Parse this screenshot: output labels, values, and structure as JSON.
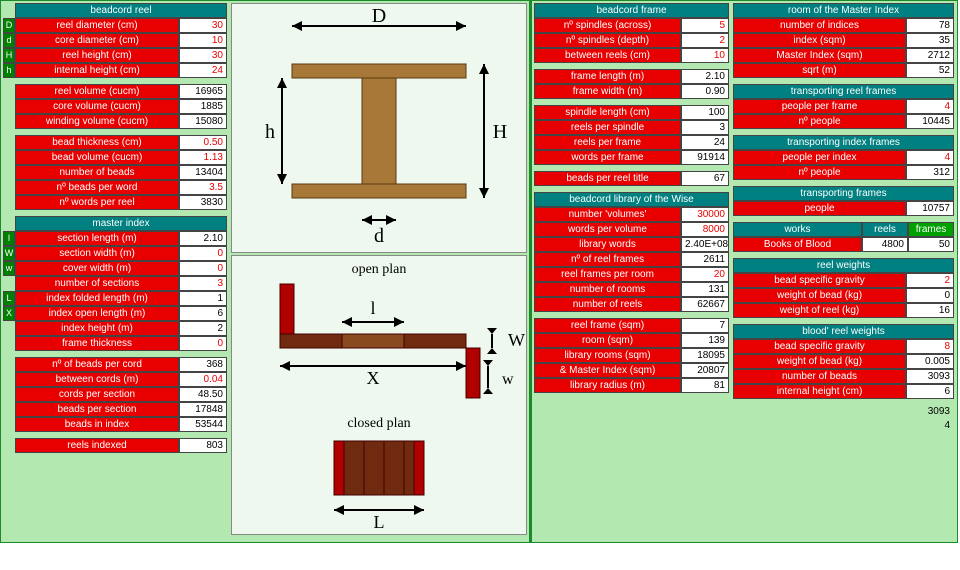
{
  "col_a": {
    "beadcord_reel": {
      "title": "beadcord reel",
      "rows": [
        {
          "tag": "D",
          "tagColor": "green",
          "label": "reel diameter (cm)",
          "value": "30",
          "red": true
        },
        {
          "tag": "d",
          "tagColor": "green",
          "label": "core diameter (cm)",
          "value": "10",
          "red": true
        },
        {
          "tag": "H",
          "tagColor": "green",
          "label": "reel height (cm)",
          "value": "30",
          "red": true
        },
        {
          "tag": "h",
          "tagColor": "green",
          "label": "internal height (cm)",
          "value": "24",
          "red": true
        }
      ]
    },
    "reel_volume": {
      "rows": [
        {
          "label": "reel volume (cucm)",
          "value": "16965"
        },
        {
          "label": "core volume (cucm)",
          "value": "1885"
        },
        {
          "label": "winding volume (cucm)",
          "value": "15080"
        }
      ]
    },
    "beads": {
      "rows": [
        {
          "label": "bead thickness (cm)",
          "value": "0.50",
          "red": true
        },
        {
          "label": "bead volume (cucm)",
          "value": "1.13",
          "red": true
        },
        {
          "label": "number of beads",
          "value": "13404"
        },
        {
          "label": "nº beads per word",
          "value": "3.5",
          "red": true
        },
        {
          "label": "nº words per reel",
          "value": "3830"
        }
      ]
    },
    "master_index": {
      "title": "master index",
      "rows": [
        {
          "tag": "l",
          "tagColor": "green",
          "label": "section length (m)",
          "value": "2.10"
        },
        {
          "tag": "W",
          "tagColor": "green",
          "label": "section width (m)",
          "value": "0",
          "red": true
        },
        {
          "tag": "w",
          "tagColor": "green",
          "label": "cover width (m)",
          "value": "0",
          "red": true
        },
        {
          "label": "number of sections",
          "value": "3",
          "red": true
        },
        {
          "tag": "L",
          "tagColor": "green",
          "label": "index folded length (m)",
          "value": "1"
        },
        {
          "tag": "X",
          "tagColor": "green",
          "label": "index open length (m)",
          "value": "6"
        },
        {
          "label": "index height (m)",
          "value": "2"
        },
        {
          "label": "frame thickness",
          "value": "0",
          "red": true
        }
      ]
    },
    "cords": {
      "rows": [
        {
          "label": "nº of beads per cord",
          "value": "368"
        },
        {
          "label": "between cords (m)",
          "value": "0.04",
          "red": true
        },
        {
          "label": "cords per section",
          "value": "48.50"
        },
        {
          "label": "beads per section",
          "value": "17848"
        },
        {
          "label": "beads in index",
          "value": "53544"
        }
      ]
    },
    "reels_indexed": {
      "rows": [
        {
          "label": "reels indexed",
          "value": "803"
        }
      ]
    }
  },
  "diagrams": {
    "open_plan": "open plan",
    "closed_plan": "closed plan",
    "D": "D",
    "d": "d",
    "H": "H",
    "h": "h",
    "l": "l",
    "L": "L",
    "W": "W",
    "w": "w",
    "X": "X"
  },
  "col_c": {
    "beadcord_frame": {
      "title": "beadcord frame",
      "rows": [
        {
          "label": "nº spindles (across)",
          "value": "5",
          "red": true
        },
        {
          "label": "nº spindles (depth)",
          "value": "2",
          "red": true
        },
        {
          "label": "between reels (cm)",
          "value": "10",
          "red": true
        }
      ]
    },
    "frame_dims": {
      "rows": [
        {
          "label": "frame length (m)",
          "value": "2.10"
        },
        {
          "label": "frame width (m)",
          "value": "0.90"
        }
      ]
    },
    "spindle": {
      "rows": [
        {
          "label": "spindle length (cm)",
          "value": "100"
        },
        {
          "label": "reels per spindle",
          "value": "3"
        },
        {
          "label": "reels per frame",
          "value": "24"
        },
        {
          "label": "words per frame",
          "value": "91914"
        }
      ]
    },
    "title_beads": {
      "rows": [
        {
          "label": "beads per reel title",
          "value": "67"
        }
      ]
    },
    "library": {
      "title": "beadcord library of the Wise",
      "rows": [
        {
          "label": "number 'volumes'",
          "value": "30000",
          "red": true
        },
        {
          "label": "words per volume",
          "value": "8000",
          "red": true
        },
        {
          "label": "library words",
          "value": "2.40E+08"
        },
        {
          "label": "nº of reel frames",
          "value": "2611"
        },
        {
          "label": "reel frames per room",
          "value": "20",
          "red": true
        },
        {
          "label": "number of rooms",
          "value": "131"
        },
        {
          "label": "number of reels",
          "value": "62667"
        }
      ]
    },
    "areas": {
      "rows": [
        {
          "label": "reel frame (sqm)",
          "value": "7"
        },
        {
          "label": "room (sqm)",
          "value": "139"
        },
        {
          "label": "library rooms (sqm)",
          "value": "18095"
        },
        {
          "label": "& Master Index (sqm)",
          "value": "20807"
        },
        {
          "label": "library radius (m)",
          "value": "81"
        }
      ]
    }
  },
  "col_d": {
    "master_room": {
      "title": "room of the Master Index",
      "rows": [
        {
          "label": "number of indices",
          "value": "78"
        },
        {
          "label": "index (sqm)",
          "value": "35"
        },
        {
          "label": "Master Index (sqm)",
          "value": "2712"
        },
        {
          "label": "sqrt (m)",
          "value": "52"
        }
      ]
    },
    "trans_reel": {
      "title": "transporting reel frames",
      "rows": [
        {
          "label": "people per frame",
          "value": "4",
          "red": true
        },
        {
          "label": "nº people",
          "value": "10445"
        }
      ]
    },
    "trans_index": {
      "title": "transporting index frames",
      "rows": [
        {
          "label": "people per index",
          "value": "4",
          "red": true
        },
        {
          "label": "nº people",
          "value": "312"
        }
      ]
    },
    "trans_frames": {
      "title": "transporting frames",
      "rows": [
        {
          "label": "people",
          "value": "10757"
        }
      ]
    },
    "works": {
      "headers": {
        "works": "works",
        "reels": "reels",
        "frames": "frames"
      },
      "rows": [
        {
          "name": "Books of Blood",
          "reels": "4800",
          "frames": "50"
        }
      ]
    },
    "reel_weights": {
      "title": "reel weights",
      "rows": [
        {
          "label": "bead specific gravity",
          "value": "2",
          "red": true
        },
        {
          "label": "weight of bead (kg)",
          "value": "0"
        },
        {
          "label": "weight of reel (kg)",
          "value": "16"
        }
      ]
    },
    "blood_weights": {
      "title": "blood' reel weights",
      "rows": [
        {
          "label": "bead specific gravity",
          "value": "8",
          "red": true
        },
        {
          "label": "weight of bead (kg)",
          "value": "0.005"
        },
        {
          "label": "number of beads",
          "value": "3093"
        },
        {
          "label": "internal height (cm)",
          "value": "6"
        }
      ]
    },
    "plain": [
      "3093",
      "4"
    ]
  }
}
